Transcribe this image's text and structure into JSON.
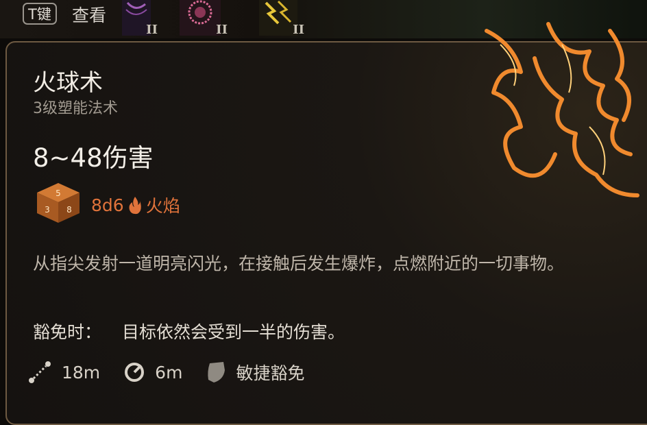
{
  "topbar": {
    "key_hint": "T键",
    "view_label": "查看",
    "slots": [
      {
        "icon": "arcane-spell-icon",
        "level": "II"
      },
      {
        "icon": "radiant-spell-icon",
        "level": "II"
      },
      {
        "icon": "lightning-spell-icon",
        "level": "II"
      }
    ]
  },
  "spell": {
    "name": "火球术",
    "subtitle": "3级塑能法术",
    "damage": "8~48伤害",
    "dice": "8d6",
    "damage_type": "火焰",
    "description": "从指尖发射一道明亮闪光，在接触后发生爆炸，点燃附近的一切事物。",
    "save_label": "豁免时：",
    "save_text": "目标依然会受到一半的伤害。"
  },
  "stats": {
    "range": "18m",
    "radius": "6m",
    "saving_throw": "敏捷豁免"
  },
  "colors": {
    "fire_accent": "#e0733b",
    "panel_border": "#6e5a42"
  }
}
